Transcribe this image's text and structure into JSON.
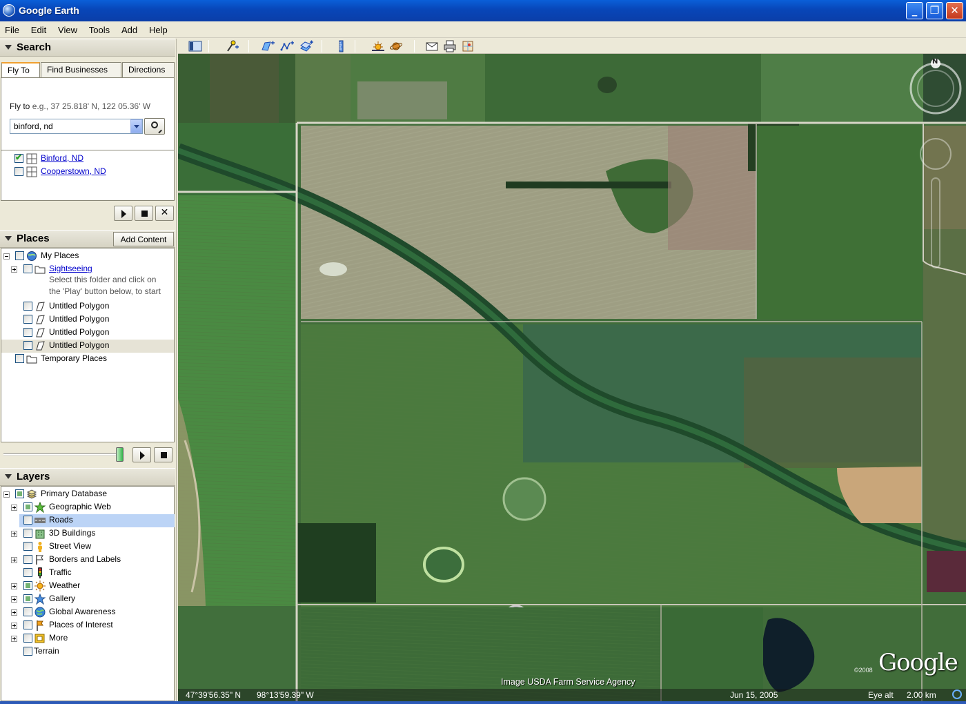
{
  "window": {
    "title": "Google Earth"
  },
  "menu": [
    "File",
    "Edit",
    "View",
    "Tools",
    "Add",
    "Help"
  ],
  "search": {
    "header": "Search",
    "tabs": [
      "Fly To",
      "Find Businesses",
      "Directions"
    ],
    "active_tab": "Fly To",
    "fly_to_label": "Fly to",
    "fly_to_example": "e.g., 37 25.818' N, 122 05.36' W",
    "input_value": "binford, nd",
    "results": [
      {
        "label": "Binford, ND",
        "checked": true
      },
      {
        "label": "Cooperstown, ND",
        "checked": false
      }
    ]
  },
  "places": {
    "header": "Places",
    "add_content": "Add Content",
    "items": {
      "my_places": "My Places",
      "sightseeing": "Sightseeing",
      "sightseeing_hint_1": "Select this folder and click on",
      "sightseeing_hint_2": "the 'Play' button below, to start",
      "polygon_1": "Untitled Polygon",
      "polygon_2": "Untitled Polygon",
      "polygon_3": "Untitled Polygon",
      "polygon_4": "Untitled Polygon",
      "temporary": "Temporary Places"
    }
  },
  "layers": {
    "header": "Layers",
    "items": {
      "primary": "Primary Database",
      "geographic_web": "Geographic Web",
      "roads": "Roads",
      "buildings": "3D Buildings",
      "street_view": "Street View",
      "borders": "Borders and Labels",
      "traffic": "Traffic",
      "weather": "Weather",
      "gallery": "Gallery",
      "global_awareness": "Global Awareness",
      "poi": "Places of Interest",
      "more": "More",
      "terrain": "Terrain"
    },
    "selected": "Roads"
  },
  "map": {
    "credit": "Image USDA Farm Service Agency",
    "logo": "Google",
    "logo_year": "©2008",
    "compass_label": "N",
    "latitude": "47°39'56.35\" N",
    "longitude": "98°13'59.39\" W",
    "date": "Jun 15, 2005",
    "eye_alt_label": "Eye alt",
    "eye_alt_value": "2.00 km"
  },
  "colors": {
    "title_bar": "#0846b8",
    "selection": "#bcd4f6",
    "panel": "#ece9d8"
  }
}
